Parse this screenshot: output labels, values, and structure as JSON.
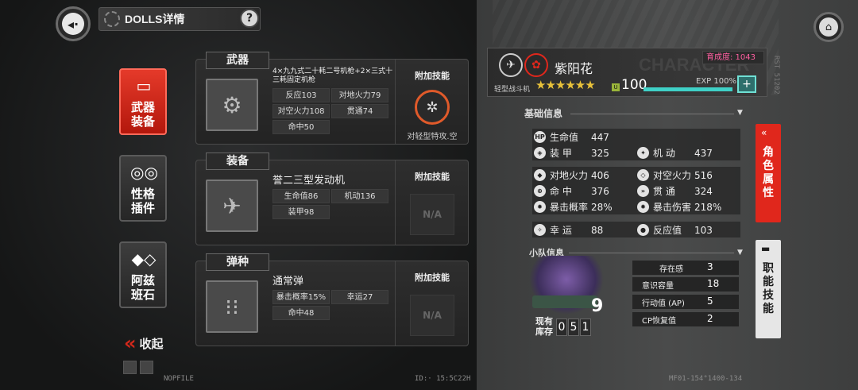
{
  "header": {
    "title": "DOLLS详情",
    "help": "?"
  },
  "sidebar": {
    "tabs": [
      {
        "label": "武器\n装备",
        "icon": "bullet-icon"
      },
      {
        "label": "性格\n插件",
        "icon": "gears-icon"
      },
      {
        "label": "阿兹\n班石",
        "icon": "dice-icon"
      }
    ],
    "collapse_label": "收起"
  },
  "equipment": {
    "weapon": {
      "category": "武器",
      "name": "4×九九式二十耗二号机枪+2×三式十三耗固定机枪",
      "stats": [
        "反应103",
        "对地火力79",
        "对空火力108",
        "贯通74",
        "命中50"
      ],
      "skill_header": "附加技能",
      "skill_caption": "对轻型特攻.空"
    },
    "gear": {
      "category": "装备",
      "name": "誉二三型发动机",
      "stats": [
        "生命值86",
        "机动136",
        "装甲98"
      ],
      "skill_header": "附加技能",
      "skill_na": "N/A"
    },
    "ammo": {
      "category": "弹种",
      "name": "通常弹",
      "stats": [
        "暴击概率15%",
        "幸运27",
        "命中48"
      ],
      "skill_header": "附加技能",
      "skill_na": "N/A"
    }
  },
  "character": {
    "name": "紫阳花",
    "type": "轻型战斗机",
    "watermark": "CHARACTER",
    "stars": "★★★★★★",
    "level_badge": "U",
    "level": "100",
    "exp_label": "EXP 100%",
    "exp_fraction": 1.0,
    "growth": "育成度: 1043"
  },
  "basic_info": {
    "title": "基础信息",
    "attributes": [
      {
        "label": "生命值",
        "value": "447",
        "icon": "hp-icon"
      },
      {
        "label": "装 甲",
        "value": "325",
        "icon": "armor-icon"
      },
      {
        "label": "机 动",
        "value": "437",
        "icon": "mobility-icon"
      },
      {
        "label": "对地火力",
        "value": "406",
        "icon": "ground-fire-icon"
      },
      {
        "label": "对空火力",
        "value": "516",
        "icon": "air-fire-icon"
      },
      {
        "label": "命 中",
        "value": "376",
        "icon": "accuracy-icon"
      },
      {
        "label": "贯 通",
        "value": "324",
        "icon": "pierce-icon"
      },
      {
        "label": "暴击概率",
        "value": "28%",
        "icon": "crit-rate-icon"
      },
      {
        "label": "暴击伤害",
        "value": "218%",
        "icon": "crit-damage-icon"
      },
      {
        "label": "幸 运",
        "value": "88",
        "icon": "luck-icon"
      },
      {
        "label": "反应值",
        "value": "103",
        "icon": "reaction-icon"
      }
    ]
  },
  "squad": {
    "title": "小队信息",
    "count": "9",
    "stock_label": "现有库存",
    "stock_digits": [
      "0",
      "5",
      "1"
    ],
    "rows": [
      {
        "label": "存在感",
        "value": "3"
      },
      {
        "label": "意识容量",
        "value": "18"
      },
      {
        "label": "行动值 (AP)",
        "value": "5"
      },
      {
        "label": "CP恢复值",
        "value": "2"
      }
    ]
  },
  "right_tabs": {
    "attributes": "角色属性",
    "skills": "职能技能"
  },
  "footer": {
    "left": "NOPFILE",
    "mid": "ID:·   15:5C22H",
    "right": "MF01-154°1400-134"
  },
  "vertical_code": "RST 51202"
}
